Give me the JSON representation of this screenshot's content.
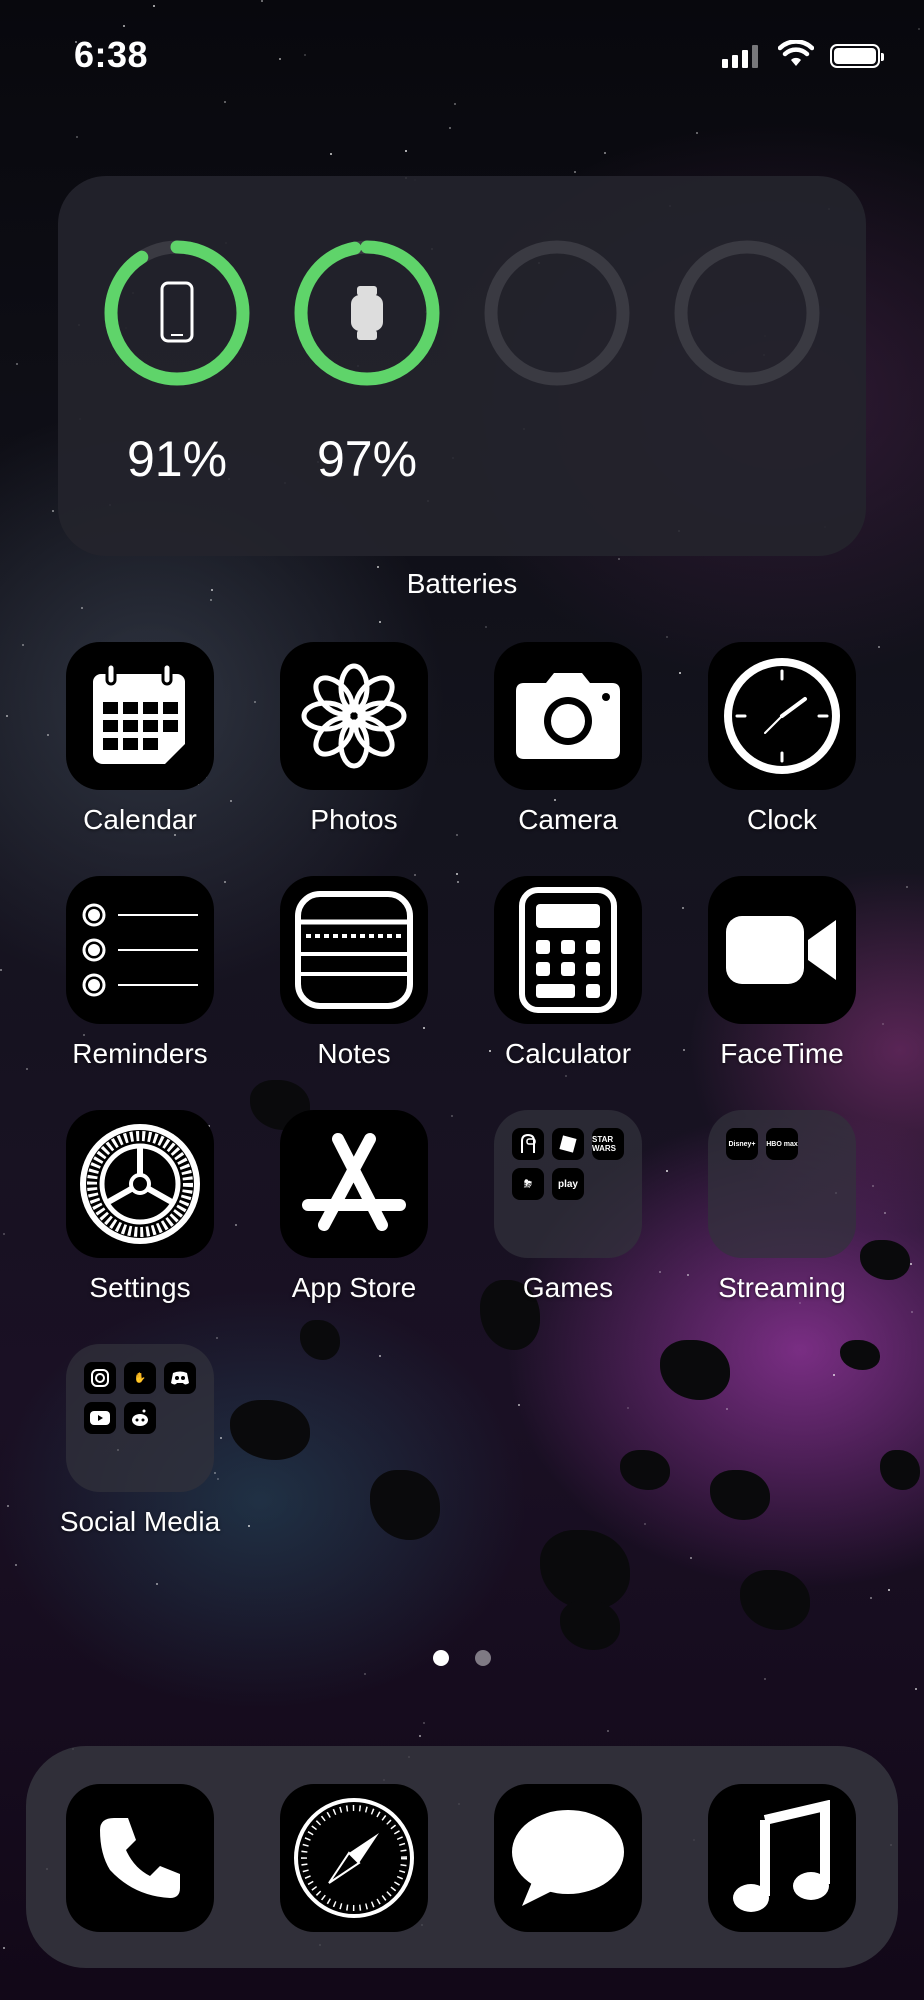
{
  "status_bar": {
    "time": "6:38"
  },
  "batteries_widget": {
    "title": "Batteries",
    "devices": [
      {
        "icon": "iphone-icon",
        "percent": 91,
        "label": "91%"
      },
      {
        "icon": "watch-icon",
        "percent": 97,
        "label": "97%"
      },
      {
        "icon": "",
        "percent": 0,
        "label": ""
      },
      {
        "icon": "",
        "percent": 0,
        "label": ""
      }
    ],
    "ring_color": "#5fd46a"
  },
  "apps": [
    {
      "label": "Calendar",
      "icon": "calendar-icon"
    },
    {
      "label": "Photos",
      "icon": "photos-flower-icon"
    },
    {
      "label": "Camera",
      "icon": "camera-icon"
    },
    {
      "label": "Clock",
      "icon": "clock-icon"
    },
    {
      "label": "Reminders",
      "icon": "reminders-list-icon"
    },
    {
      "label": "Notes",
      "icon": "notes-icon"
    },
    {
      "label": "Calculator",
      "icon": "calculator-icon"
    },
    {
      "label": "FaceTime",
      "icon": "video-camera-icon"
    },
    {
      "label": "Settings",
      "icon": "gear-icon"
    },
    {
      "label": "App Store",
      "icon": "app-store-icon"
    },
    {
      "label": "Games",
      "icon": "folder-icon"
    },
    {
      "label": "Streaming",
      "icon": "folder-icon"
    },
    {
      "label": "Social Media",
      "icon": "folder-icon"
    }
  ],
  "folders": {
    "games_minis": [
      "",
      "",
      "STAR WARS",
      "",
      "play"
    ],
    "streaming_minis": [
      "Disney+",
      "HBO max"
    ],
    "social_minis": [
      "instagram",
      "clubhouse",
      "discord",
      "youtube",
      "reddit"
    ]
  },
  "page_dots": {
    "count": 2,
    "active": 0
  },
  "dock": [
    {
      "icon": "phone-icon"
    },
    {
      "icon": "compass-icon"
    },
    {
      "icon": "message-bubble-icon"
    },
    {
      "icon": "music-note-icon"
    }
  ]
}
